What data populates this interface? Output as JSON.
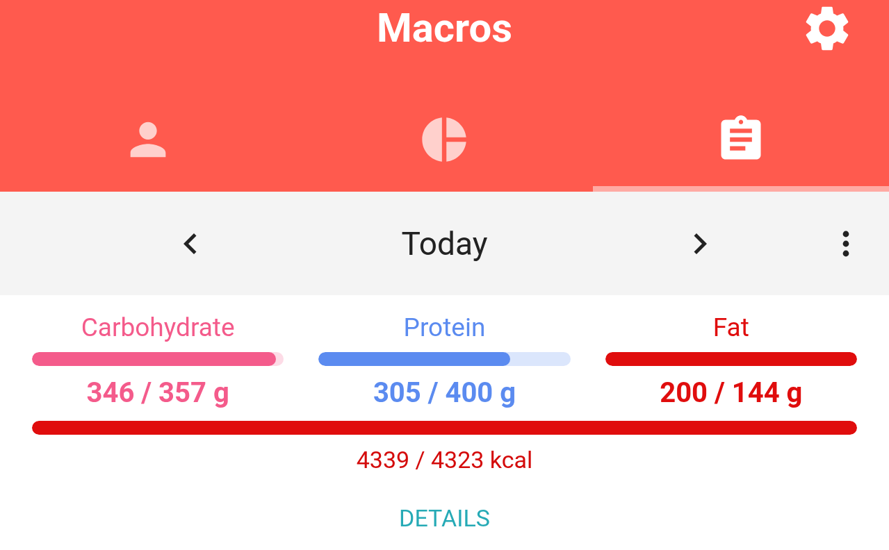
{
  "app_bar": {
    "title": "Macros"
  },
  "tabs": [
    {
      "kind": "person",
      "selected": false
    },
    {
      "kind": "chart",
      "selected": false
    },
    {
      "kind": "clipboard",
      "selected": true
    }
  ],
  "date_bar": {
    "label": "Today"
  },
  "macros": [
    {
      "name": "Carbohydrate",
      "color": "#f45b8b",
      "level": 0.97,
      "reading": "346 / 357 g"
    },
    {
      "name": "Protein",
      "color": "#5b8bf0",
      "level": 0.76,
      "reading": "305 / 400 g"
    },
    {
      "name": "Fat",
      "color": "#e00d0d",
      "level": 1,
      "reading": "200 / 144 g"
    }
  ],
  "calories": {
    "level": 1,
    "reading": "4339 / 4323 kcal"
  },
  "details_button": "DETAILS"
}
